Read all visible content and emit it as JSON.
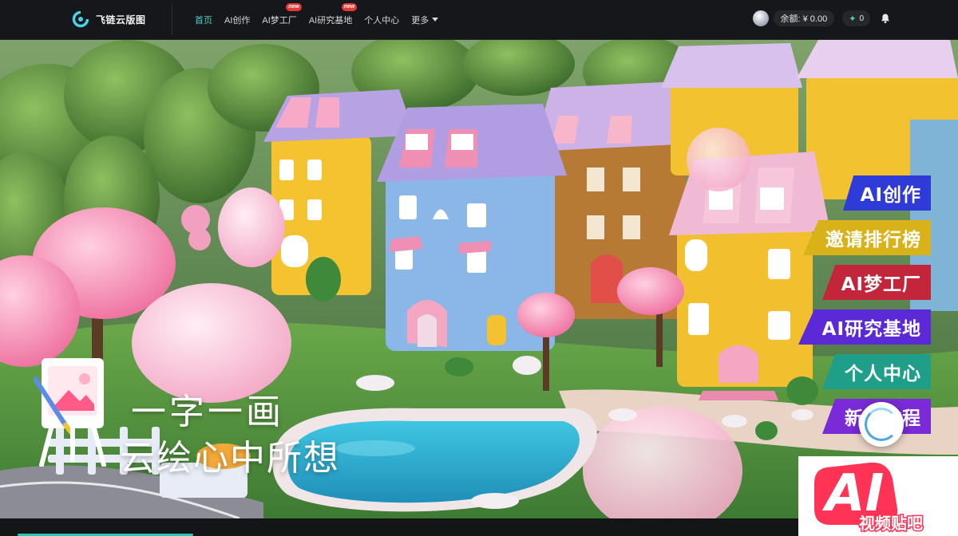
{
  "brand": {
    "name": "飞链云版图"
  },
  "nav": {
    "items": [
      {
        "label": "首页",
        "active": true,
        "badge": ""
      },
      {
        "label": "AI创作",
        "active": false,
        "badge": ""
      },
      {
        "label": "AI梦工厂",
        "active": false,
        "badge": "new"
      },
      {
        "label": "AI研究基地",
        "active": false,
        "badge": "new"
      },
      {
        "label": "个人中心",
        "active": false,
        "badge": ""
      },
      {
        "label": "更多",
        "active": false,
        "badge": ""
      }
    ]
  },
  "account": {
    "balance": "余额: ¥ 0.00",
    "coins": "0"
  },
  "hero": {
    "slogan_line1": "一字一画",
    "slogan_line2": "云绘心中所想"
  },
  "side_menu": [
    {
      "label": "AI创作",
      "color": "#2f3bd6"
    },
    {
      "label": "邀请排行榜",
      "color": "#d9b21a"
    },
    {
      "label": "AI梦工厂",
      "color": "#c3263a"
    },
    {
      "label": "AI研究基地",
      "color": "#5b2ad6"
    },
    {
      "label": "个人中心",
      "color": "#1f9f8a"
    },
    {
      "label": "新人教程",
      "color": "#7a2ad6"
    }
  ],
  "watermark": {
    "big": "AI",
    "small": "视频贴吧"
  },
  "colors": {
    "accent": "#4fd1c5",
    "topbar": "#16171a",
    "badge": "#e53935"
  },
  "icons": [
    "logo-icon",
    "avatar",
    "coin-icon",
    "bell-icon",
    "caret-down-icon",
    "easel-icon"
  ]
}
